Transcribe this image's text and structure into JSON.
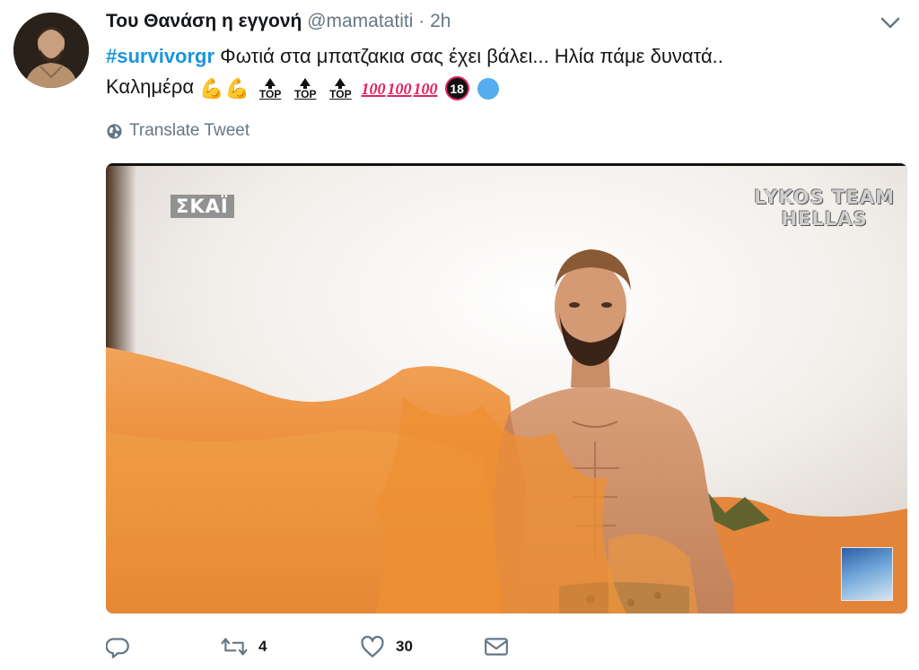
{
  "tweet": {
    "display_name": "Του Θανάση η εγγονή",
    "handle": "@mamatatiti",
    "separator": "·",
    "time": "2h",
    "hashtag": "#survivorgr",
    "text_line1": " Φωτιά στα μπατζακια σας έχει βάλει... Ηλία πάμε δυνατά..",
    "text_line2": "Καλημέρα ",
    "emojis": {
      "flexed_biceps": "💪",
      "top_label": "TOP",
      "hundred": "100",
      "no_under_18": "18"
    },
    "translate_label": "Translate Tweet"
  },
  "media": {
    "channel_logo": "ΣΚΑΪ",
    "team_logo_line1": "LYKOS TEAM",
    "team_logo_line2": "HELLAS"
  },
  "actions": {
    "retweet_count": "4",
    "like_count": "30"
  },
  "icons": {
    "caret": "chevron-down-icon",
    "globe": "globe-icon",
    "reply": "reply-icon",
    "retweet": "retweet-icon",
    "like": "heart-icon",
    "dm": "envelope-icon"
  },
  "colors": {
    "hashtag": "#1b95e0",
    "secondary_text": "#657786",
    "hundred": "#e0245e"
  }
}
